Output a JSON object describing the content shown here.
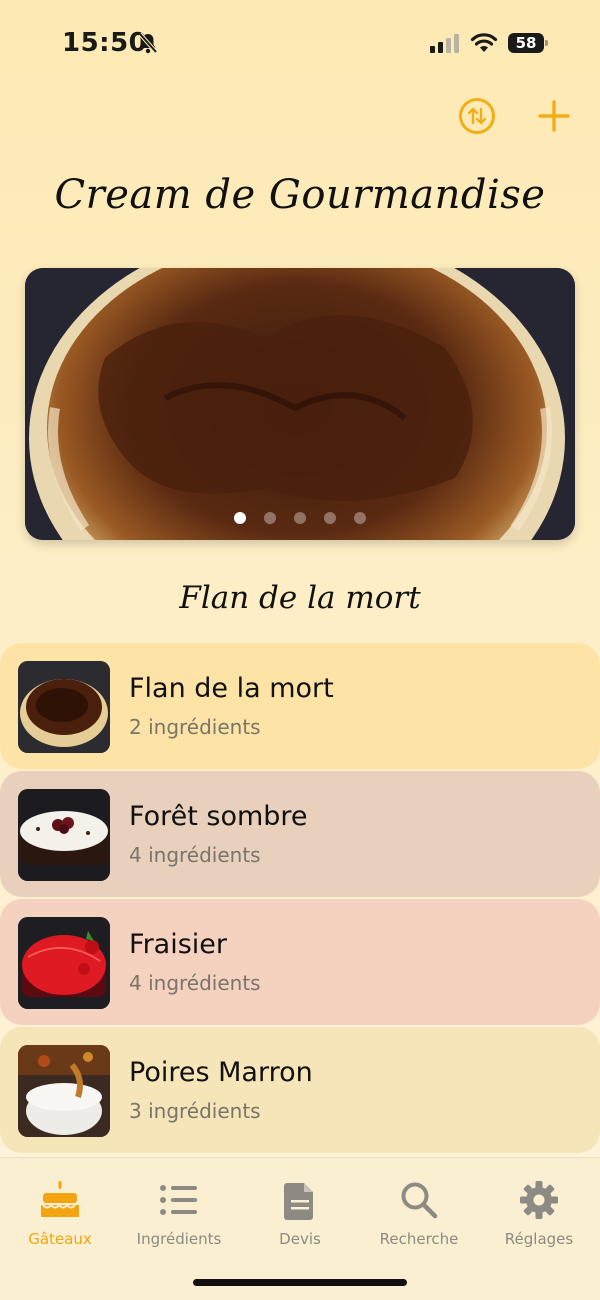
{
  "status_bar": {
    "time": "15:50",
    "battery": "58"
  },
  "header": {
    "app_title": "Cream de Gourmandise"
  },
  "carousel": {
    "caption": "Flan de la mort",
    "page_count": 5,
    "active_index": 0
  },
  "cakes": [
    {
      "name": "Flan de la mort",
      "ingredients": "2 ingrédients",
      "bg": "#fde3a6"
    },
    {
      "name": "Forêt sombre",
      "ingredients": "4 ingrédients",
      "bg": "#e8d0bd"
    },
    {
      "name": "Fraisier",
      "ingredients": "4 ingrédients",
      "bg": "#f5d2c0"
    },
    {
      "name": "Poires Marron",
      "ingredients": "3 ingrédients",
      "bg": "#f5e5b8"
    }
  ],
  "tabbar": {
    "tabs": [
      {
        "label": "Gâteaux",
        "icon": "cake-icon",
        "active": true
      },
      {
        "label": "Ingrédients",
        "icon": "list-icon",
        "active": false
      },
      {
        "label": "Devis",
        "icon": "document-icon",
        "active": false
      },
      {
        "label": "Recherche",
        "icon": "search-icon",
        "active": false
      },
      {
        "label": "Réglages",
        "icon": "gear-icon",
        "active": false
      }
    ]
  },
  "colors": {
    "accent": "#f2ae17",
    "inactive": "#8d8a84"
  }
}
